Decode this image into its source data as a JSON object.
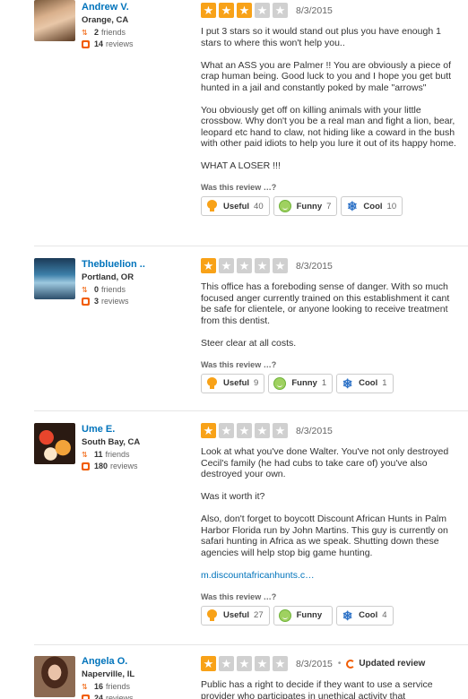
{
  "review_prompt": "Was this review …?",
  "buttons": {
    "useful": "Useful",
    "funny": "Funny",
    "cool": "Cool"
  },
  "colors": {
    "accent": "#f15c00",
    "star_on": "#f8a218",
    "star_off": "#d0d0d0",
    "link": "#0073bb"
  },
  "reviews": [
    {
      "user": {
        "name": "Andrew V.",
        "location": "Orange, CA",
        "friends": "2",
        "friends_label": "friends",
        "reviews": "14",
        "reviews_label": "reviews"
      },
      "rating": 3,
      "date": "8/3/2015",
      "paragraphs": [
        "I put 3 stars so it would stand out plus you have enough 1 stars to where this won't help you..",
        "What an ASS you are Palmer !! You are obviously a piece of crap human being. Good luck to you and I hope you get butt hunted in a jail and constantly poked by male \"arrows\"",
        "You obviously get off on killing animals with your little crossbow. Why don't you be a real man and fight a lion, bear, leopard etc hand to claw, not hiding  like a coward in the bush with other paid idiots to help you lure it out of its happy home.",
        "WHAT A LOSER !!!"
      ],
      "votes": {
        "useful": "40",
        "funny": "7",
        "cool": "10"
      }
    },
    {
      "user": {
        "name": "Thebluelion ..",
        "location": "Portland, OR",
        "friends": "0",
        "friends_label": "friends",
        "reviews": "3",
        "reviews_label": "reviews"
      },
      "rating": 1,
      "date": "8/3/2015",
      "paragraphs": [
        "This office has a foreboding sense of danger. With so much focused anger currently trained on this establishment it cant be safe for clientele, or anyone looking to receive treatment from this dentist.",
        "Steer clear at all costs."
      ],
      "votes": {
        "useful": "9",
        "funny": "1",
        "cool": "1"
      }
    },
    {
      "user": {
        "name": "Ume E.",
        "location": "South Bay, CA",
        "friends": "11",
        "friends_label": "friends",
        "reviews": "180",
        "reviews_label": "reviews"
      },
      "rating": 1,
      "date": "8/3/2015",
      "paragraphs": [
        "Look at what you've done Walter. You've not only destroyed Cecil's family (he had cubs to take care of) you've also destroyed your own.",
        "Was it worth it?",
        "Also, don't forget to boycott Discount African Hunts in Palm Harbor Florida run by John Martins. This guy is currently on safari hunting in Africa as we speak. Shutting down these agencies will help stop big game hunting."
      ],
      "link": "m.discountafricanhunts.c…",
      "votes": {
        "useful": "27",
        "funny": "",
        "cool": "4"
      }
    },
    {
      "user": {
        "name": "Angela O.",
        "location": "Naperville, IL",
        "friends": "16",
        "friends_label": "friends",
        "reviews": "24",
        "reviews_label": "reviews"
      },
      "rating": 1,
      "date": "8/3/2015",
      "updated_label": "Updated review",
      "paragraphs": [
        "Public has a right to decide if they want to use a service provider who participates in unethical activity that"
      ]
    }
  ]
}
